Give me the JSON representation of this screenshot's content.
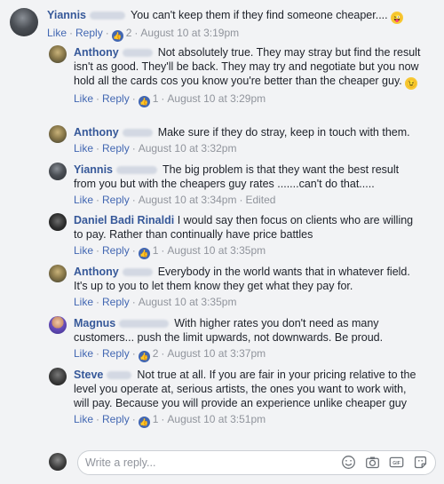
{
  "comments": [
    {
      "name": "Yiannis",
      "text": "You can't keep them if they find someone cheaper....",
      "emoji": "😜",
      "like_label": "Like",
      "reply_label": "Reply",
      "likes": "2",
      "time": "August 10 at 3:19pm"
    },
    {
      "name": "Anthony",
      "text": "Not absolutely true. They may stray but find the result isn't as good. They'll be back. They may try and negotiate but you now hold all the cards cos you know you're better than the cheaper guy.",
      "emoji": "😉",
      "like_label": "Like",
      "reply_label": "Reply",
      "likes": "1",
      "time": "August 10 at 3:29pm"
    },
    {
      "name": "Anthony",
      "text": "Make sure if they do stray, keep in touch with them.",
      "like_label": "Like",
      "reply_label": "Reply",
      "time": "August 10 at 3:32pm"
    },
    {
      "name": "Yiannis",
      "text": "The big problem is that they want the best result from you but with the cheapers guy rates .......can't do that.....",
      "like_label": "Like",
      "reply_label": "Reply",
      "time": "August 10 at 3:34pm",
      "edited": "Edited"
    },
    {
      "name": "Daniel Badi Rinaldi",
      "text": "I would say then focus on clients who are willing to pay. Rather than continually have price battles",
      "like_label": "Like",
      "reply_label": "Reply",
      "likes": "1",
      "time": "August 10 at 3:35pm"
    },
    {
      "name": "Anthony",
      "text": "Everybody in the world wants that in whatever field. It's up to you to let them know they get what they pay for.",
      "like_label": "Like",
      "reply_label": "Reply",
      "time": "August 10 at 3:35pm"
    },
    {
      "name": "Magnus",
      "text": "With higher rates you don't need as many customers... push the limit upwards, not downwards. Be proud.",
      "like_label": "Like",
      "reply_label": "Reply",
      "likes": "2",
      "time": "August 10 at 3:37pm"
    },
    {
      "name": "Steve",
      "text": "Not true at all. If you are fair in your pricing relative to the level you operate at, serious artists, the ones you want to work with, will pay. Because you will provide an experience unlike cheaper guy",
      "like_label": "Like",
      "reply_label": "Reply",
      "likes": "1",
      "time": "August 10 at 3:51pm"
    }
  ],
  "reply_box": {
    "placeholder": "Write a reply...",
    "icons": [
      "smiley-icon",
      "camera-icon",
      "gif-icon",
      "sticker-icon"
    ]
  },
  "colors": {
    "link": "#365899",
    "action_link": "#4267b2",
    "meta": "#90949c",
    "background": "#f2f3f5"
  }
}
